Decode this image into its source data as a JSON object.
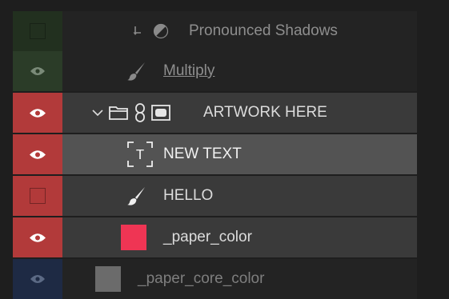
{
  "colors": {
    "background": "#1e1e1e",
    "vis_green": "#22301f",
    "vis_green_light": "#2b3c28",
    "vis_red": "#b23a3a",
    "vis_blue": "#1e2a44",
    "row_dark": "#232323",
    "row_mid": "#3a3a3a",
    "row_selected": "#535353",
    "swatch_red": "#ef3554",
    "swatch_gray": "#6b6b6b"
  },
  "layers": [
    {
      "label": "Pronounced Shadows",
      "type": "adjustment",
      "visible": false,
      "dimmed": true
    },
    {
      "label": "Multiply",
      "type": "paint",
      "visible": true,
      "dimmed": true,
      "underlined": true
    },
    {
      "label": "ARTWORK HERE",
      "type": "group",
      "visible": true,
      "expanded": true
    },
    {
      "label": "NEW TEXT",
      "type": "text",
      "visible": true,
      "selected": true
    },
    {
      "label": "HELLO",
      "type": "paint",
      "visible": false
    },
    {
      "label": "_paper_color",
      "type": "fill",
      "visible": true
    },
    {
      "label": "_paper_core_color",
      "type": "fill",
      "visible": true,
      "dimmed": true
    }
  ]
}
